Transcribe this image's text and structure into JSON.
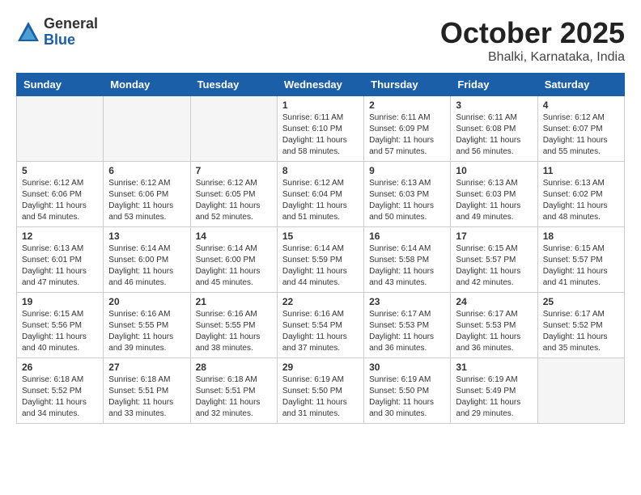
{
  "header": {
    "logo_general": "General",
    "logo_blue": "Blue",
    "month_title": "October 2025",
    "location": "Bhalki, Karnataka, India"
  },
  "weekdays": [
    "Sunday",
    "Monday",
    "Tuesday",
    "Wednesday",
    "Thursday",
    "Friday",
    "Saturday"
  ],
  "weeks": [
    [
      {
        "day": "",
        "info": ""
      },
      {
        "day": "",
        "info": ""
      },
      {
        "day": "",
        "info": ""
      },
      {
        "day": "1",
        "info": "Sunrise: 6:11 AM\nSunset: 6:10 PM\nDaylight: 11 hours\nand 58 minutes."
      },
      {
        "day": "2",
        "info": "Sunrise: 6:11 AM\nSunset: 6:09 PM\nDaylight: 11 hours\nand 57 minutes."
      },
      {
        "day": "3",
        "info": "Sunrise: 6:11 AM\nSunset: 6:08 PM\nDaylight: 11 hours\nand 56 minutes."
      },
      {
        "day": "4",
        "info": "Sunrise: 6:12 AM\nSunset: 6:07 PM\nDaylight: 11 hours\nand 55 minutes."
      }
    ],
    [
      {
        "day": "5",
        "info": "Sunrise: 6:12 AM\nSunset: 6:06 PM\nDaylight: 11 hours\nand 54 minutes."
      },
      {
        "day": "6",
        "info": "Sunrise: 6:12 AM\nSunset: 6:06 PM\nDaylight: 11 hours\nand 53 minutes."
      },
      {
        "day": "7",
        "info": "Sunrise: 6:12 AM\nSunset: 6:05 PM\nDaylight: 11 hours\nand 52 minutes."
      },
      {
        "day": "8",
        "info": "Sunrise: 6:12 AM\nSunset: 6:04 PM\nDaylight: 11 hours\nand 51 minutes."
      },
      {
        "day": "9",
        "info": "Sunrise: 6:13 AM\nSunset: 6:03 PM\nDaylight: 11 hours\nand 50 minutes."
      },
      {
        "day": "10",
        "info": "Sunrise: 6:13 AM\nSunset: 6:03 PM\nDaylight: 11 hours\nand 49 minutes."
      },
      {
        "day": "11",
        "info": "Sunrise: 6:13 AM\nSunset: 6:02 PM\nDaylight: 11 hours\nand 48 minutes."
      }
    ],
    [
      {
        "day": "12",
        "info": "Sunrise: 6:13 AM\nSunset: 6:01 PM\nDaylight: 11 hours\nand 47 minutes."
      },
      {
        "day": "13",
        "info": "Sunrise: 6:14 AM\nSunset: 6:00 PM\nDaylight: 11 hours\nand 46 minutes."
      },
      {
        "day": "14",
        "info": "Sunrise: 6:14 AM\nSunset: 6:00 PM\nDaylight: 11 hours\nand 45 minutes."
      },
      {
        "day": "15",
        "info": "Sunrise: 6:14 AM\nSunset: 5:59 PM\nDaylight: 11 hours\nand 44 minutes."
      },
      {
        "day": "16",
        "info": "Sunrise: 6:14 AM\nSunset: 5:58 PM\nDaylight: 11 hours\nand 43 minutes."
      },
      {
        "day": "17",
        "info": "Sunrise: 6:15 AM\nSunset: 5:57 PM\nDaylight: 11 hours\nand 42 minutes."
      },
      {
        "day": "18",
        "info": "Sunrise: 6:15 AM\nSunset: 5:57 PM\nDaylight: 11 hours\nand 41 minutes."
      }
    ],
    [
      {
        "day": "19",
        "info": "Sunrise: 6:15 AM\nSunset: 5:56 PM\nDaylight: 11 hours\nand 40 minutes."
      },
      {
        "day": "20",
        "info": "Sunrise: 6:16 AM\nSunset: 5:55 PM\nDaylight: 11 hours\nand 39 minutes."
      },
      {
        "day": "21",
        "info": "Sunrise: 6:16 AM\nSunset: 5:55 PM\nDaylight: 11 hours\nand 38 minutes."
      },
      {
        "day": "22",
        "info": "Sunrise: 6:16 AM\nSunset: 5:54 PM\nDaylight: 11 hours\nand 37 minutes."
      },
      {
        "day": "23",
        "info": "Sunrise: 6:17 AM\nSunset: 5:53 PM\nDaylight: 11 hours\nand 36 minutes."
      },
      {
        "day": "24",
        "info": "Sunrise: 6:17 AM\nSunset: 5:53 PM\nDaylight: 11 hours\nand 36 minutes."
      },
      {
        "day": "25",
        "info": "Sunrise: 6:17 AM\nSunset: 5:52 PM\nDaylight: 11 hours\nand 35 minutes."
      }
    ],
    [
      {
        "day": "26",
        "info": "Sunrise: 6:18 AM\nSunset: 5:52 PM\nDaylight: 11 hours\nand 34 minutes."
      },
      {
        "day": "27",
        "info": "Sunrise: 6:18 AM\nSunset: 5:51 PM\nDaylight: 11 hours\nand 33 minutes."
      },
      {
        "day": "28",
        "info": "Sunrise: 6:18 AM\nSunset: 5:51 PM\nDaylight: 11 hours\nand 32 minutes."
      },
      {
        "day": "29",
        "info": "Sunrise: 6:19 AM\nSunset: 5:50 PM\nDaylight: 11 hours\nand 31 minutes."
      },
      {
        "day": "30",
        "info": "Sunrise: 6:19 AM\nSunset: 5:50 PM\nDaylight: 11 hours\nand 30 minutes."
      },
      {
        "day": "31",
        "info": "Sunrise: 6:19 AM\nSunset: 5:49 PM\nDaylight: 11 hours\nand 29 minutes."
      },
      {
        "day": "",
        "info": ""
      }
    ]
  ]
}
